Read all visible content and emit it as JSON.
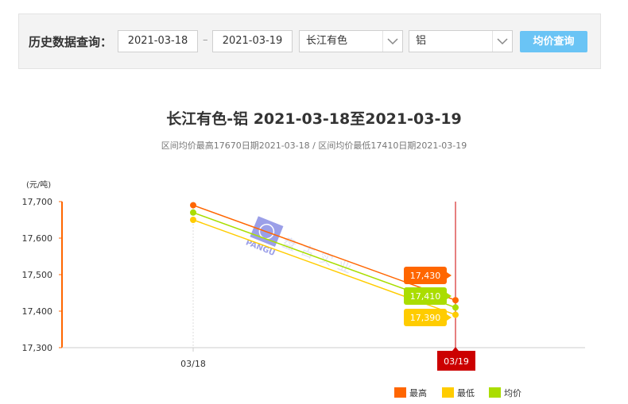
{
  "query": {
    "label": "历史数据查询：",
    "start_date": "2021-03-18",
    "separator": "–",
    "end_date": "2021-03-19",
    "market_select": "长江有色",
    "metal_select": "铝",
    "button_label": "均价查询"
  },
  "chart_data": {
    "type": "line",
    "title": "长江有色-铝 2021-03-18至2021-03-19",
    "subtitle": "区间均价最高17670日期2021-03-18 / 区间均价最低17410日期2021-03-19",
    "ylabel": "(元/吨)",
    "categories": [
      "03/18",
      "03/19"
    ],
    "ylim": [
      17300,
      17700
    ],
    "yticks": [
      17300,
      17400,
      17500,
      17600,
      17700
    ],
    "ytick_labels": [
      "17,300",
      "17,400",
      "17,500",
      "17,600",
      "17,700"
    ],
    "grid": false,
    "legend_position": "bottom-right",
    "series": [
      {
        "name": "最高",
        "color": "#ff6600",
        "values": [
          17690,
          17430
        ],
        "end_label": "17,430"
      },
      {
        "name": "最低",
        "color": "#ffcc00",
        "values": [
          17650,
          17390
        ],
        "end_label": "17,390"
      },
      {
        "name": "均价",
        "color": "#aadd00",
        "values": [
          17670,
          17410
        ],
        "end_label": "17,410"
      }
    ],
    "crosshair_label": "03/19",
    "watermark": "盘古实业 PANGU"
  },
  "colors": {
    "axis": "#ff6600",
    "crosshair": "#cc0000",
    "button": "#6ac4f5"
  }
}
